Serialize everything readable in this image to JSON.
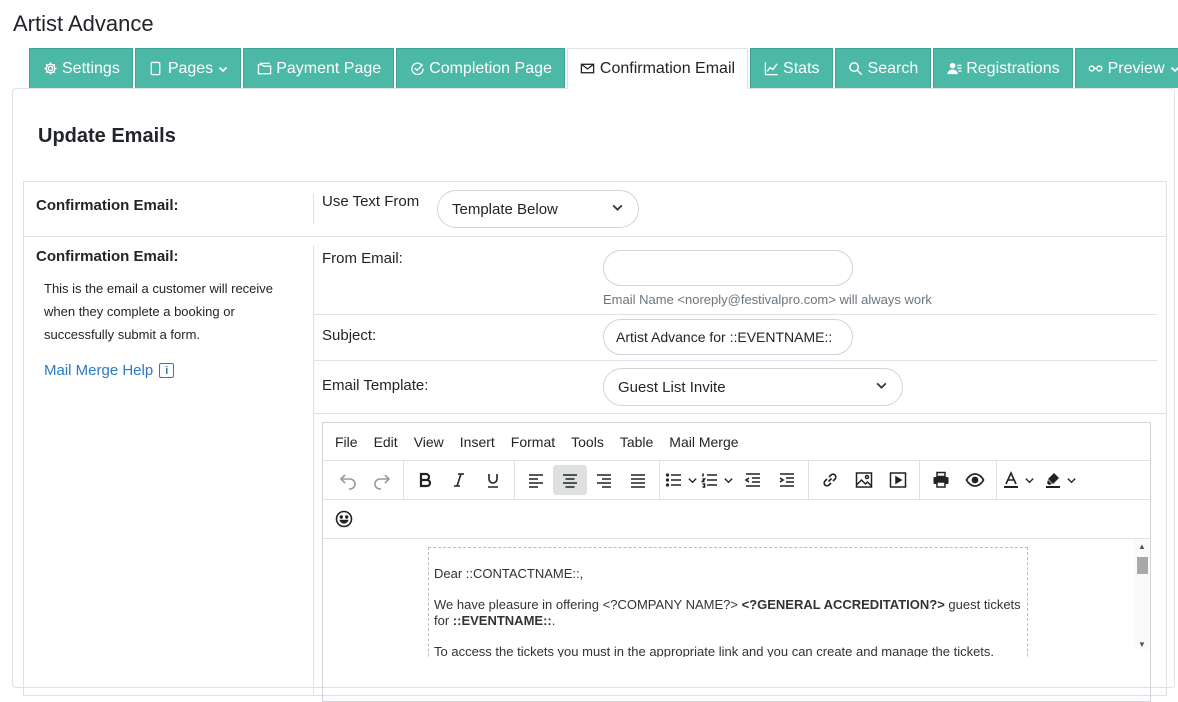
{
  "app": {
    "title": "Artist Advance"
  },
  "tabs": [
    {
      "label": "Settings",
      "icon": "gear-icon"
    },
    {
      "label": "Pages",
      "icon": "page-icon",
      "caret": true
    },
    {
      "label": "Payment Page",
      "icon": "folder-icon"
    },
    {
      "label": "Completion Page",
      "icon": "check-circle-icon"
    },
    {
      "label": "Confirmation Email",
      "icon": "envelope-icon",
      "active": true
    },
    {
      "label": "Stats",
      "icon": "chart-line-icon"
    },
    {
      "label": "Search",
      "icon": "search-icon"
    },
    {
      "label": "Registrations",
      "icon": "users-icon"
    },
    {
      "label": "Preview",
      "icon": "glasses-icon",
      "caret": true
    }
  ],
  "card": {
    "title": "Update Emails"
  },
  "use_text": {
    "label": "Confirmation Email:",
    "text": "Use Text From",
    "selected": "Template Below"
  },
  "email": {
    "label": "Confirmation Email:",
    "description": "This is the email a customer will receive when they complete a booking or successfully submit a form.",
    "help": "Mail Merge Help",
    "help_icon": "i",
    "from_label": "From Email:",
    "from_value": "",
    "from_hint": "Email Name <noreply@festivalpro.com> will always work",
    "subject_label": "Subject:",
    "subject_value": "Artist Advance for ::EVENTNAME::",
    "template_label": "Email Template:",
    "template_selected": "Guest List Invite"
  },
  "editor": {
    "menu": [
      "File",
      "Edit",
      "View",
      "Insert",
      "Format",
      "Tools",
      "Table",
      "Mail Merge"
    ],
    "body": {
      "greeting": "Dear ::CONTACTNAME::,",
      "line1_a": "We have pleasure in offering <?COMPANY NAME?> ",
      "line1_b": "<?GENERAL ACCREDITATION?>",
      "line1_c": " guest tickets for ",
      "line1_d": "::EVENTNAME::",
      "line1_e": ".",
      "line2": "To access the tickets you must in the appropriate link and you can create and manage the tickets."
    }
  },
  "colors": {
    "tab_bg": "#4cb8a6",
    "link": "#2a7ac7",
    "border": "#dee2e6"
  }
}
